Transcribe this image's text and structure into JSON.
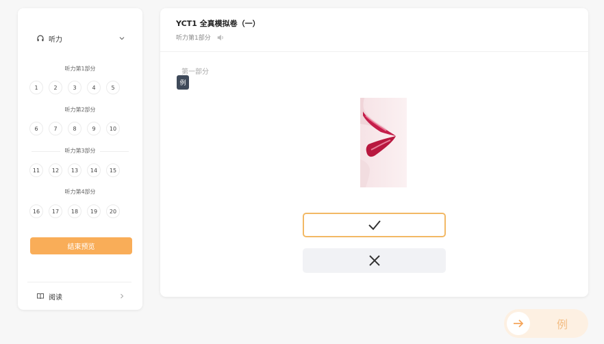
{
  "sidebar": {
    "listening": {
      "label": "听力",
      "icon": "headphones-icon"
    },
    "parts": [
      {
        "label": "听力第1部分",
        "questions": [
          "1",
          "2",
          "3",
          "4",
          "5"
        ]
      },
      {
        "label": "听力第2部分",
        "questions": [
          "6",
          "7",
          "8",
          "9",
          "10"
        ]
      },
      {
        "label": "听力第3部分",
        "questions": [
          "11",
          "12",
          "13",
          "14",
          "15"
        ]
      },
      {
        "label": "听力第4部分",
        "questions": [
          "16",
          "17",
          "18",
          "19",
          "20"
        ]
      }
    ],
    "end_button": "结束预览",
    "reading": {
      "label": "阅读",
      "icon": "book-icon"
    }
  },
  "main": {
    "title": "YCT1 全真模拟卷（一）",
    "subtitle": "听力第1部分",
    "part_title": "第一部分",
    "example_badge": "例",
    "options": [
      {
        "name": "true-option",
        "icon": "check-icon",
        "selected": true
      },
      {
        "name": "false-option",
        "icon": "cross-icon",
        "selected": false
      }
    ]
  },
  "next": {
    "label": "例",
    "icon": "arrow-right-icon"
  },
  "colors": {
    "accent": "#f9ad58",
    "selected_border": "#f2b864",
    "badge_bg": "#3f4a5a",
    "page_bg": "#f7f7f7"
  }
}
